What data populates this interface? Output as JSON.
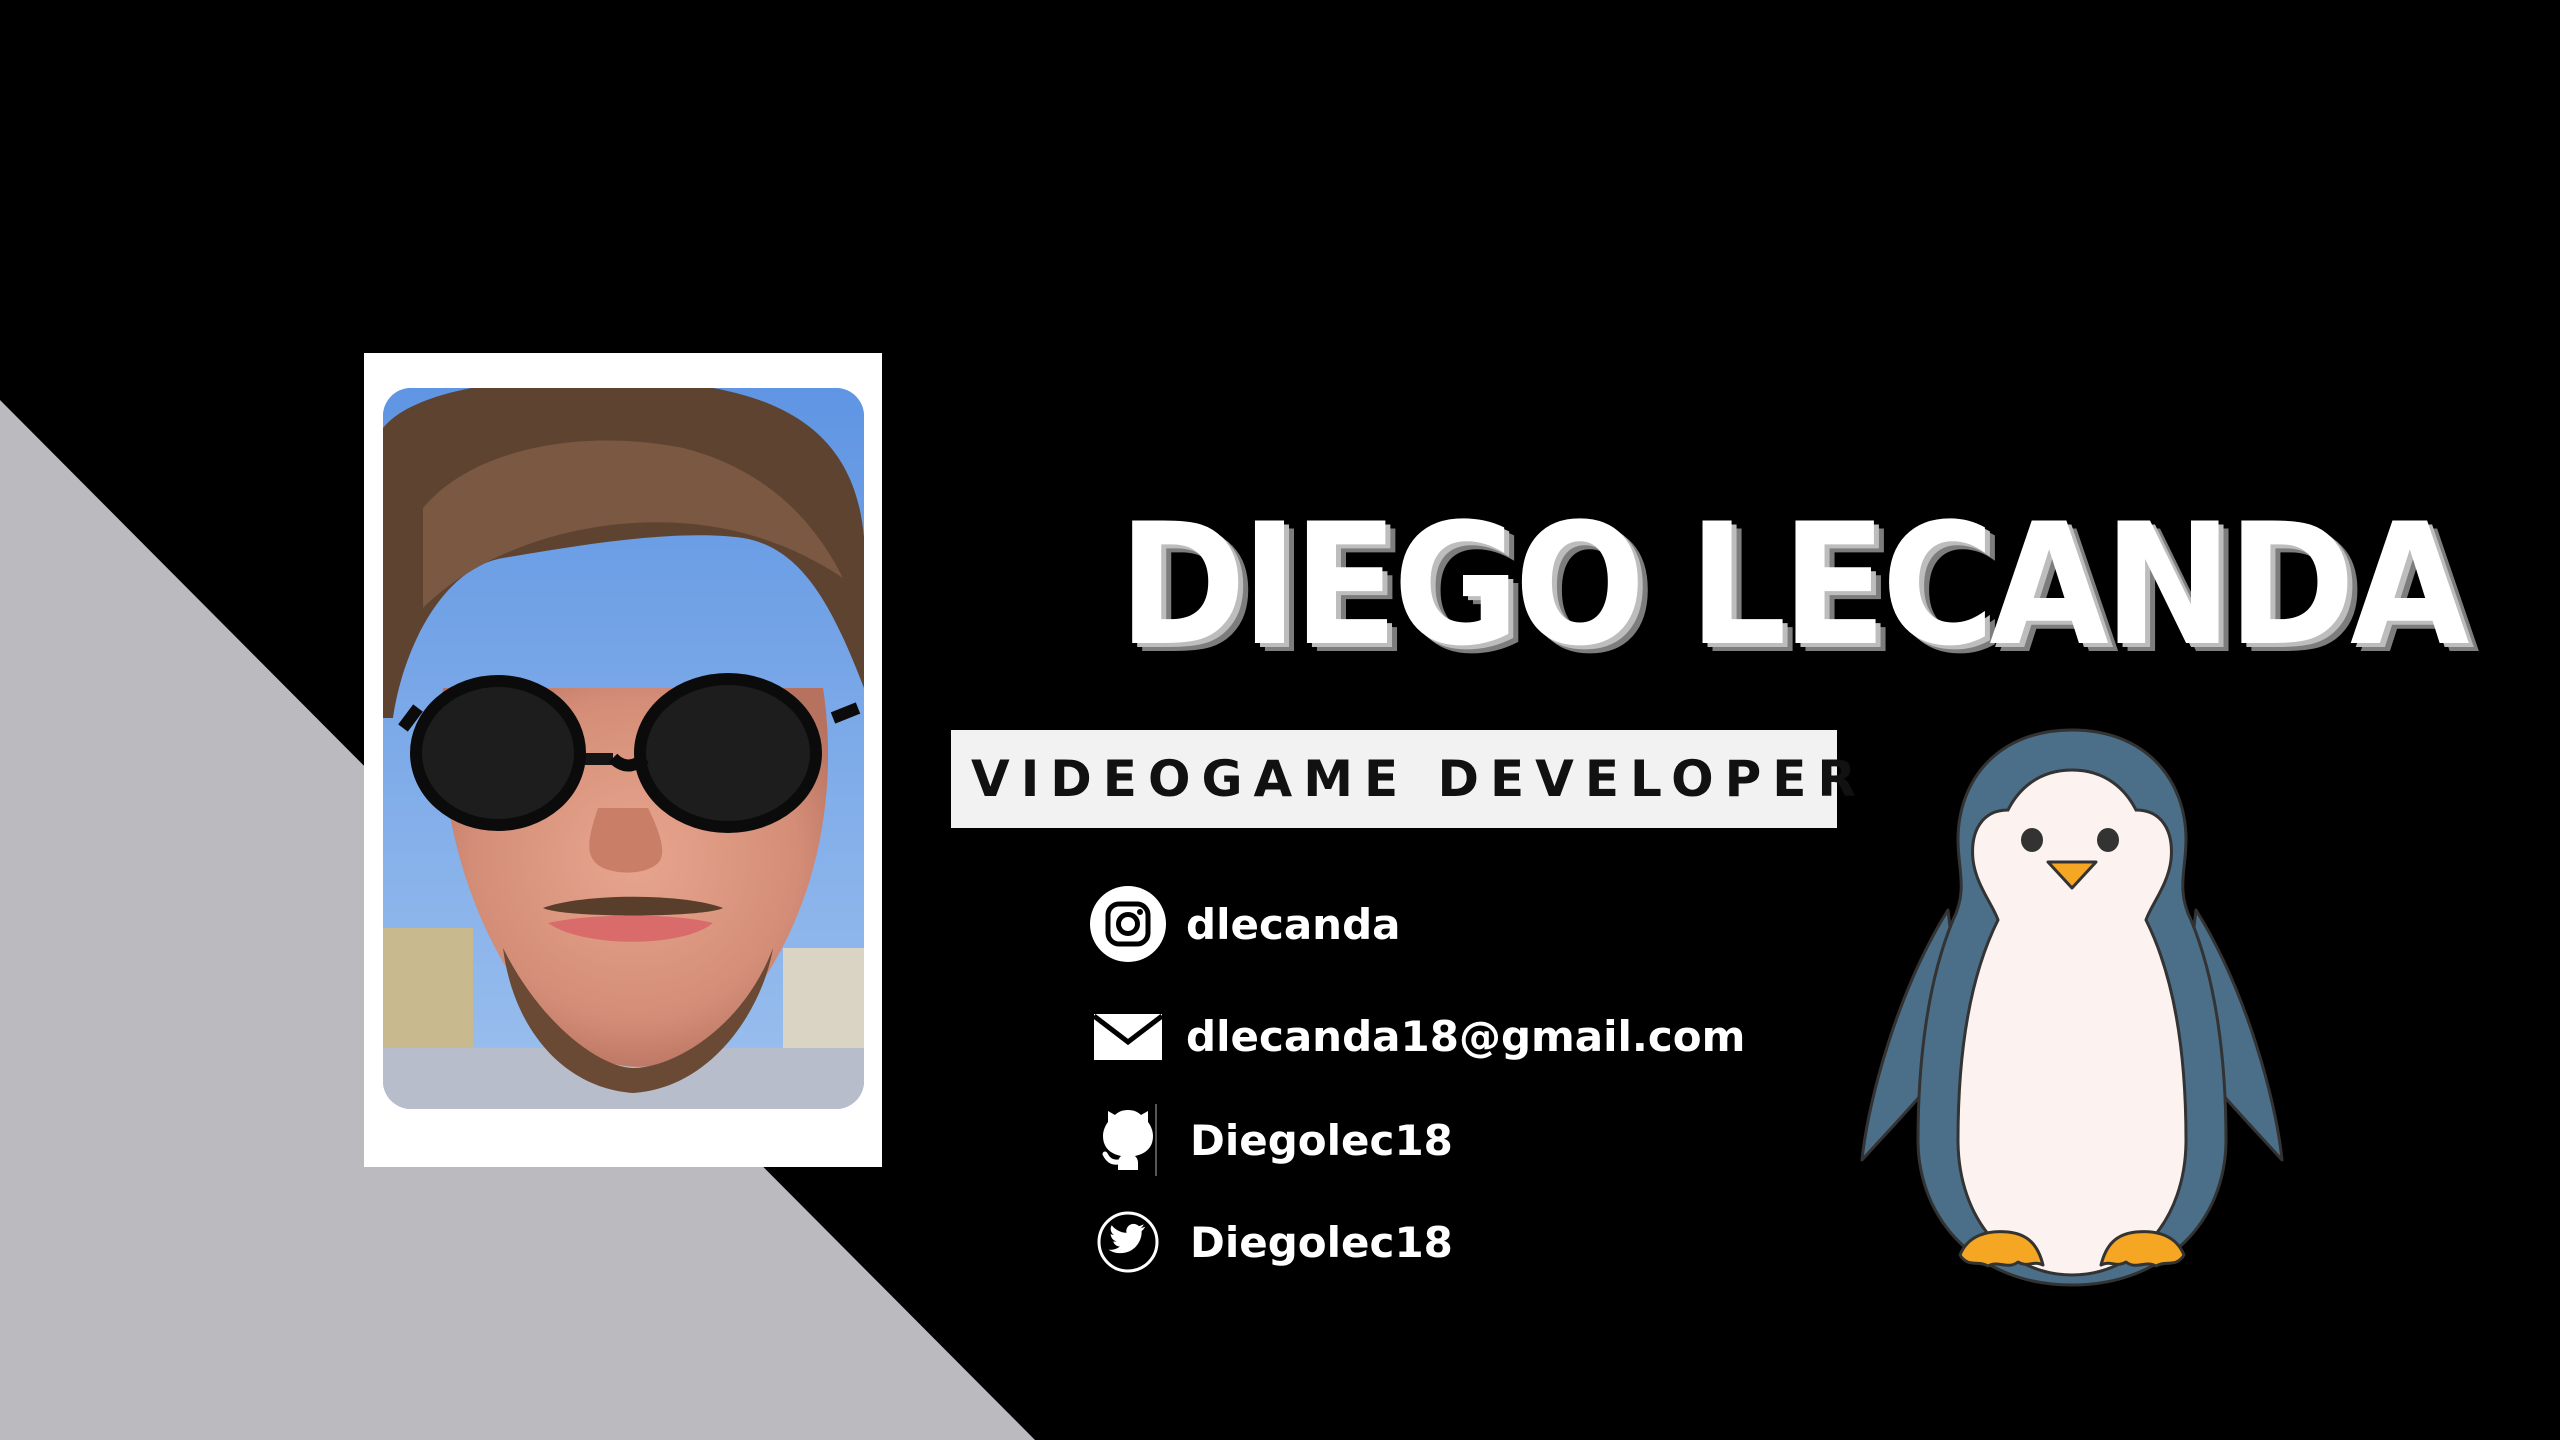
{
  "card": {
    "name": "DIEGO LECANDA",
    "role": "VIDEOGAME DEVELOPER"
  },
  "contacts": {
    "instagram": {
      "icon": "instagram-icon",
      "label": "dlecanda"
    },
    "email": {
      "icon": "mail-icon",
      "label": "dlecanda18@gmail.com"
    },
    "github": {
      "icon": "github-icon",
      "label": "Diegolec18"
    },
    "twitter": {
      "icon": "twitter-icon",
      "label": "Diegolec18"
    }
  },
  "colors": {
    "background": "#000000",
    "accent_triangle": "#bbbbbf",
    "banner": "#f2f2f2",
    "penguin_body": "#4b6f89",
    "penguin_belly": "#fcf2f0",
    "penguin_feet": "#f5a623"
  }
}
